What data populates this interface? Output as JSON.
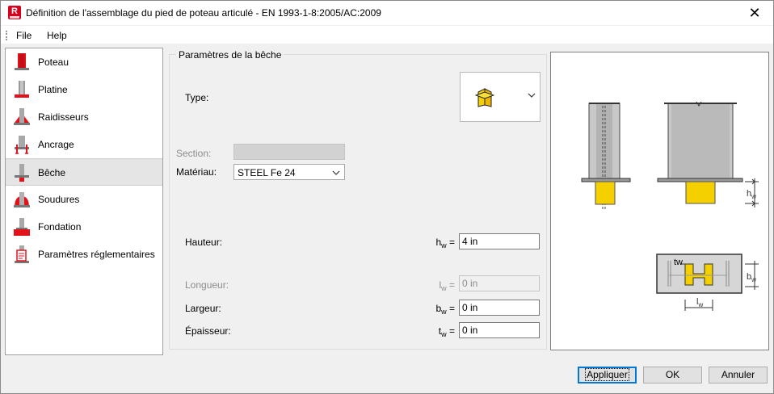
{
  "window": {
    "title": "Définition de l'assemblage du pied de poteau articulé - EN 1993-1-8:2005/AC:2009",
    "close_glyph": "✕"
  },
  "menu": {
    "file": "File",
    "help": "Help"
  },
  "nav": {
    "items": [
      {
        "label": "Poteau",
        "icon": "column-icon"
      },
      {
        "label": "Platine",
        "icon": "base-plate-icon"
      },
      {
        "label": "Raidisseurs",
        "icon": "stiffeners-icon"
      },
      {
        "label": "Ancrage",
        "icon": "anchorage-icon"
      },
      {
        "label": "Bêche",
        "icon": "shear-key-icon",
        "selected": true
      },
      {
        "label": "Soudures",
        "icon": "welds-icon"
      },
      {
        "label": "Fondation",
        "icon": "foundation-icon"
      },
      {
        "label": "Paramètres réglementaires",
        "icon": "code-parameters-icon"
      }
    ]
  },
  "group": {
    "title": "Paramètres de la bêche"
  },
  "form": {
    "type_label": "Type:",
    "section_label": "Section:",
    "material_label": "Matériau:",
    "material_value": "STEEL Fe 24",
    "height_label": "Hauteur:",
    "height_symbol": "h",
    "height_sub": "w",
    "height_eq": "=",
    "height_value": "4 in",
    "length_label": "Longueur:",
    "length_symbol": "l",
    "length_sub": "w",
    "length_eq": "=",
    "length_value": "0 in",
    "width_label": "Largeur:",
    "width_symbol": "b",
    "width_sub": "w",
    "width_eq": "=",
    "width_value": "0 in",
    "thickness_label": "Épaisseur:",
    "thickness_symbol": "t",
    "thickness_sub": "w",
    "thickness_eq": "=",
    "thickness_value": "0 in"
  },
  "preview": {
    "hw": "h",
    "hw_sub": "w",
    "bw": "b",
    "bw_sub": "w",
    "lw": "l",
    "lw_sub": "w",
    "tw": "tw"
  },
  "buttons": {
    "apply": "Appliquer",
    "ok": "OK",
    "cancel": "Annuler"
  },
  "colors": {
    "accent": "#0078d7",
    "red": "#e2121b",
    "yellow": "#f5d000",
    "steel": "#bdbdbd"
  }
}
